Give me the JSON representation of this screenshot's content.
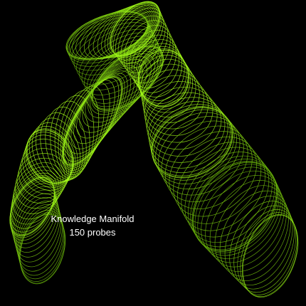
{
  "artwork": {
    "background": "#000000",
    "line_color_dark": "#3f7f00",
    "line_color_bright": "#a6ff1a",
    "loop_count": 150
  },
  "caption": {
    "title": "Knowledge Manifold",
    "subtitle": "150 probes",
    "color": "#ffffff"
  }
}
